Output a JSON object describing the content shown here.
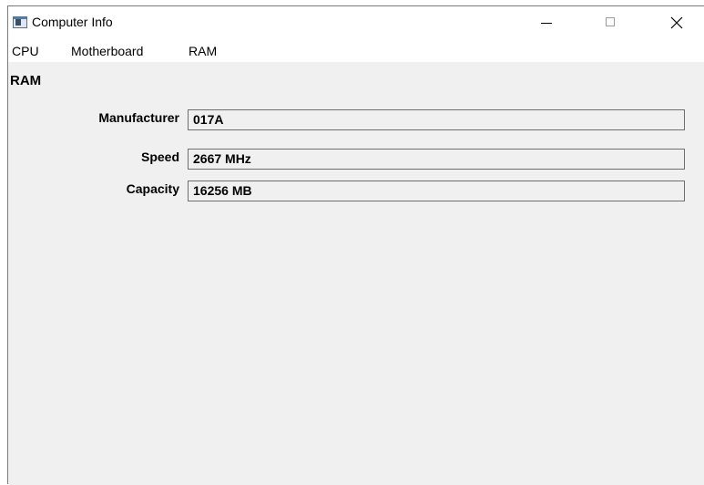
{
  "window": {
    "title": "Computer Info"
  },
  "menu": {
    "items": [
      {
        "label": "CPU"
      },
      {
        "label": "Motherboard"
      },
      {
        "label": "RAM"
      }
    ]
  },
  "section": {
    "title": "RAM"
  },
  "fields": [
    {
      "label": "Manufacturer",
      "value": "017A"
    },
    {
      "label": "Speed",
      "value": "2667 MHz"
    },
    {
      "label": "Capacity",
      "value": "16256 MB"
    }
  ],
  "icons": {
    "app": "app-window-icon",
    "minimize": "minimize-icon",
    "maximize": "maximize-icon",
    "close": "close-icon"
  },
  "colors": {
    "client_background": "#f0f0f0",
    "titlebar_background": "#ffffff",
    "field_border": "#6e6e6e"
  }
}
